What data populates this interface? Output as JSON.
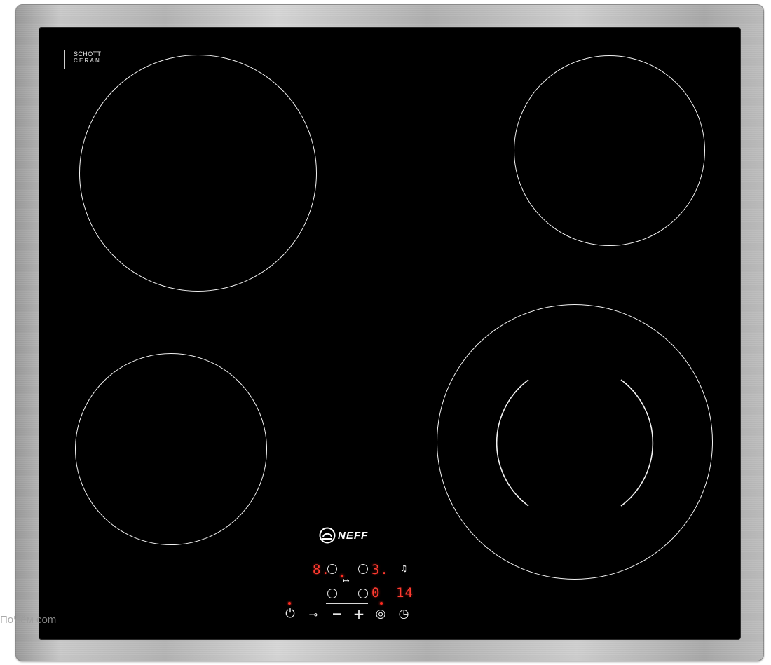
{
  "glass_badge": {
    "line1": "SCHOTT",
    "line2": "CERAN"
  },
  "brand": {
    "name": "NEFF"
  },
  "display": {
    "zone_front_left_level": "8.",
    "zone_rear_right_level": "3.",
    "zone_front_right_level": "0",
    "timer_minutes": "14"
  },
  "controls": {
    "power_symbol": "⏻",
    "lock_symbol": "⊸",
    "minus_symbol": "−",
    "plus_symbol": "+",
    "power_boost_symbol": "◎",
    "timer_symbol": "◷",
    "bell_symbol": "♫",
    "timer_link_symbol": "↦"
  },
  "watermark": {
    "text": "ПоЧём com"
  },
  "colors": {
    "glass": "#000000",
    "frame": "#b8b8b8",
    "display_red": "#ff3b30",
    "zone_outline": "#f2f2f2"
  },
  "icons": {
    "power": "power-icon",
    "lock": "key-lock-icon",
    "minus": "minus-icon",
    "plus": "plus-icon",
    "boost": "power-boost-icon",
    "timer": "timer-icon",
    "bell": "bell-icon"
  }
}
